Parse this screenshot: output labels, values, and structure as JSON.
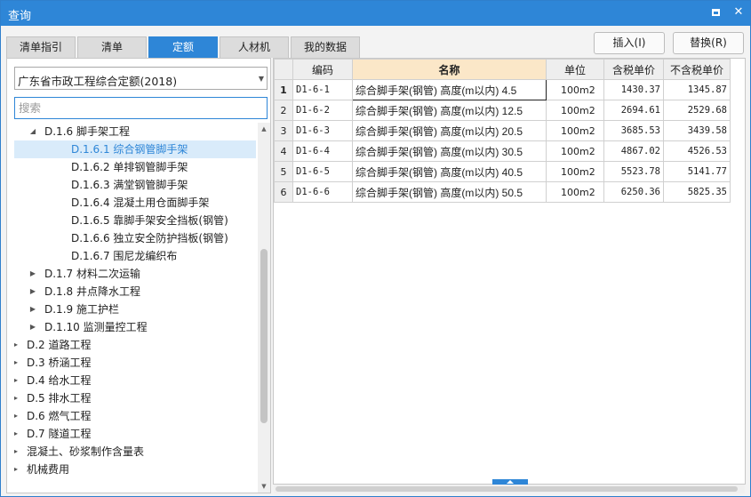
{
  "window": {
    "title": "查询"
  },
  "tabs": [
    {
      "label": "清单指引",
      "active": false
    },
    {
      "label": "清单",
      "active": false
    },
    {
      "label": "定额",
      "active": true
    },
    {
      "label": "人材机",
      "active": false
    },
    {
      "label": "我的数据",
      "active": false
    }
  ],
  "library_select": {
    "value": "广东省市政工程综合定额(2018)"
  },
  "search": {
    "placeholder": "搜索",
    "value": ""
  },
  "tree": [
    {
      "label": "D.1.6 脚手架工程",
      "level": 1,
      "toggle": "expanded",
      "selected": false
    },
    {
      "label": "D.1.6.1 综合钢管脚手架",
      "level": 2,
      "toggle": "none",
      "selected": true
    },
    {
      "label": "D.1.6.2 单排钢管脚手架",
      "level": 2,
      "toggle": "none",
      "selected": false
    },
    {
      "label": "D.1.6.3 满堂钢管脚手架",
      "level": 2,
      "toggle": "none",
      "selected": false
    },
    {
      "label": "D.1.6.4 混凝土用仓面脚手架",
      "level": 2,
      "toggle": "none",
      "selected": false
    },
    {
      "label": "D.1.6.5 靠脚手架安全挡板(钢管)",
      "level": 2,
      "toggle": "none",
      "selected": false
    },
    {
      "label": "D.1.6.6 独立安全防护挡板(钢管)",
      "level": 2,
      "toggle": "none",
      "selected": false
    },
    {
      "label": "D.1.6.7 围尼龙编织布",
      "level": 2,
      "toggle": "none",
      "selected": false
    },
    {
      "label": "D.1.7 材料二次运输",
      "level": 1,
      "toggle": "collapsed",
      "selected": false
    },
    {
      "label": "D.1.8 井点降水工程",
      "level": 1,
      "toggle": "collapsed",
      "selected": false
    },
    {
      "label": "D.1.9 施工护栏",
      "level": 1,
      "toggle": "collapsed",
      "selected": false
    },
    {
      "label": "D.1.10 监测量控工程",
      "level": 1,
      "toggle": "collapsed",
      "selected": false
    },
    {
      "label": "D.2 道路工程",
      "level": 0,
      "toggle": "collapsed",
      "selected": false
    },
    {
      "label": "D.3 桥涵工程",
      "level": 0,
      "toggle": "collapsed",
      "selected": false
    },
    {
      "label": "D.4 给水工程",
      "level": 0,
      "toggle": "collapsed",
      "selected": false
    },
    {
      "label": "D.5 排水工程",
      "level": 0,
      "toggle": "collapsed",
      "selected": false
    },
    {
      "label": "D.6 燃气工程",
      "level": 0,
      "toggle": "collapsed",
      "selected": false
    },
    {
      "label": "D.7 隧道工程",
      "level": 0,
      "toggle": "collapsed",
      "selected": false
    },
    {
      "label": "混凝土、砂浆制作含量表",
      "level": 0,
      "toggle": "collapsed",
      "selected": false
    },
    {
      "label": "机械费用",
      "level": 0,
      "toggle": "collapsed",
      "selected": false
    }
  ],
  "buttons": {
    "insert": "插入(I)",
    "replace": "替换(R)"
  },
  "table": {
    "columns": [
      "编码",
      "名称",
      "单位",
      "含税单价",
      "不含税单价"
    ],
    "rows": [
      {
        "rn": "1",
        "code": "D1-6-1",
        "name": "综合脚手架(钢管) 高度(m以内) 4.5",
        "unit": "100m2",
        "tax_price": "1430.37",
        "notax_price": "1345.87"
      },
      {
        "rn": "2",
        "code": "D1-6-2",
        "name": "综合脚手架(钢管) 高度(m以内) 12.5",
        "unit": "100m2",
        "tax_price": "2694.61",
        "notax_price": "2529.68"
      },
      {
        "rn": "3",
        "code": "D1-6-3",
        "name": "综合脚手架(钢管) 高度(m以内) 20.5",
        "unit": "100m2",
        "tax_price": "3685.53",
        "notax_price": "3439.58"
      },
      {
        "rn": "4",
        "code": "D1-6-4",
        "name": "综合脚手架(钢管) 高度(m以内) 30.5",
        "unit": "100m2",
        "tax_price": "4867.02",
        "notax_price": "4526.53"
      },
      {
        "rn": "5",
        "code": "D1-6-5",
        "name": "综合脚手架(钢管) 高度(m以内) 40.5",
        "unit": "100m2",
        "tax_price": "5523.78",
        "notax_price": "5141.77"
      },
      {
        "rn": "6",
        "code": "D1-6-6",
        "name": "综合脚手架(钢管) 高度(m以内) 50.5",
        "unit": "100m2",
        "tax_price": "6250.36",
        "notax_price": "5825.35"
      }
    ]
  }
}
